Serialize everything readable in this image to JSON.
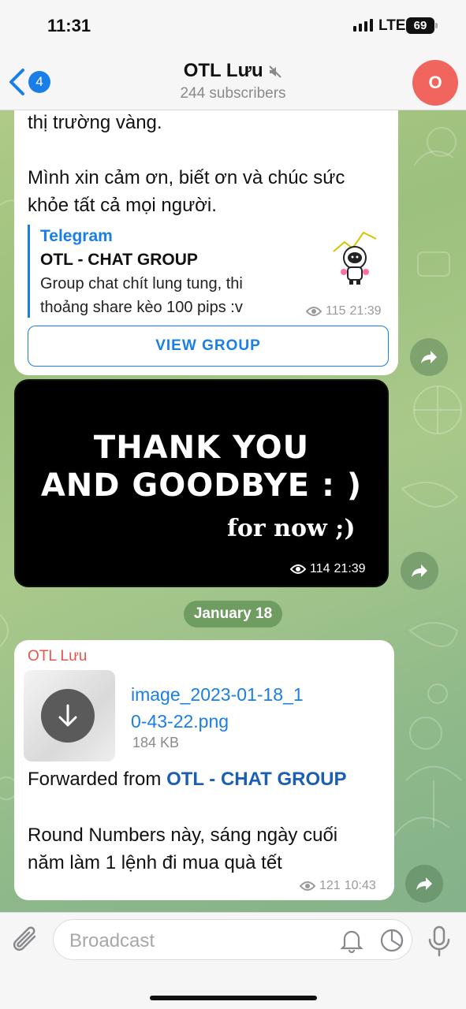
{
  "status_bar": {
    "time": "11:31",
    "network": "LTE",
    "battery": "69"
  },
  "header": {
    "back_count": "4",
    "title": "OTL Lưu",
    "muted_icon": "speaker-muted-icon",
    "subtitle": "244 subscribers",
    "avatar_letter": "O",
    "avatar_color": "#f0665e"
  },
  "messages": [
    {
      "text_lines": [
        "thị trường vàng.",
        "",
        "Mình xin cảm ơn, biết ơn và chúc sức",
        "khỏe tất cả mọi người."
      ],
      "link_preview": {
        "site": "Telegram",
        "title": "OTL - CHAT GROUP",
        "description": "Group chat chít lung tung, thi thoảng share kèo 100 pips :v"
      },
      "views": "115",
      "time": "21:39",
      "button_label": "VIEW GROUP"
    },
    {
      "image_text": [
        "THANK YOU",
        "AND GOODBYE  :  )",
        "for now ;)"
      ],
      "views": "114",
      "time": "21:39"
    },
    {
      "date_separator": "January 18",
      "sender": "OTL Lưu",
      "file_name": "image_2023-01-18_10-43-22.png",
      "file_name_lines": [
        "image_2023-01-18_1",
        "0-43-22.png"
      ],
      "file_size": "184 KB",
      "forwarded_prefix": "Forwarded from ",
      "forwarded_source": "OTL - CHAT GROUP",
      "text_lines": [
        "Round Numbers này, sáng ngày cuối",
        "năm làm 1 lệnh đi mua quà tết"
      ],
      "views": "121",
      "time": "10:43"
    }
  ],
  "composer": {
    "placeholder": "Broadcast"
  },
  "colors": {
    "accent": "#1a7ee8",
    "sender": "#e8534d"
  }
}
